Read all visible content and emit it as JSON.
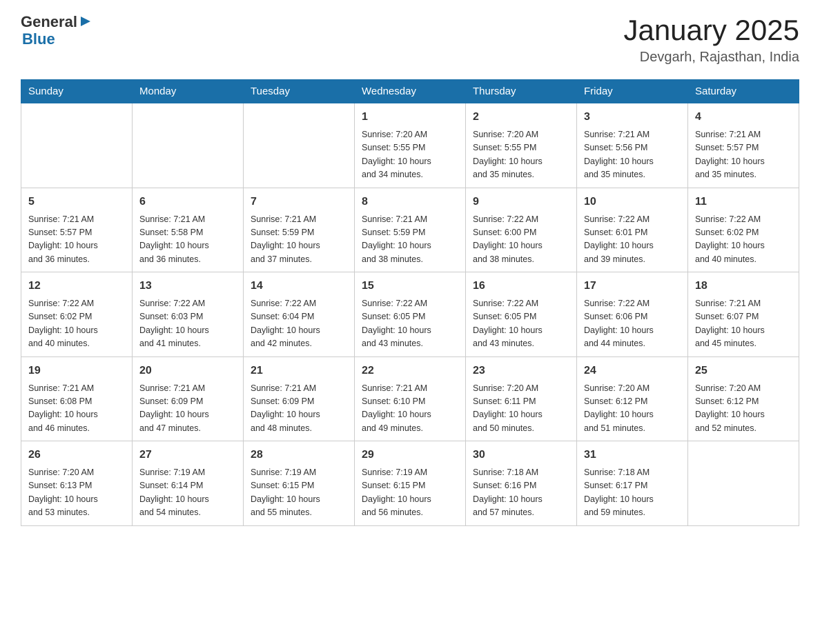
{
  "header": {
    "logo": {
      "general": "General",
      "blue": "Blue"
    },
    "title": "January 2025",
    "subtitle": "Devgarh, Rajasthan, India"
  },
  "days_of_week": [
    "Sunday",
    "Monday",
    "Tuesday",
    "Wednesday",
    "Thursday",
    "Friday",
    "Saturday"
  ],
  "weeks": [
    [
      {
        "day": "",
        "info": ""
      },
      {
        "day": "",
        "info": ""
      },
      {
        "day": "",
        "info": ""
      },
      {
        "day": "1",
        "info": "Sunrise: 7:20 AM\nSunset: 5:55 PM\nDaylight: 10 hours\nand 34 minutes."
      },
      {
        "day": "2",
        "info": "Sunrise: 7:20 AM\nSunset: 5:55 PM\nDaylight: 10 hours\nand 35 minutes."
      },
      {
        "day": "3",
        "info": "Sunrise: 7:21 AM\nSunset: 5:56 PM\nDaylight: 10 hours\nand 35 minutes."
      },
      {
        "day": "4",
        "info": "Sunrise: 7:21 AM\nSunset: 5:57 PM\nDaylight: 10 hours\nand 35 minutes."
      }
    ],
    [
      {
        "day": "5",
        "info": "Sunrise: 7:21 AM\nSunset: 5:57 PM\nDaylight: 10 hours\nand 36 minutes."
      },
      {
        "day": "6",
        "info": "Sunrise: 7:21 AM\nSunset: 5:58 PM\nDaylight: 10 hours\nand 36 minutes."
      },
      {
        "day": "7",
        "info": "Sunrise: 7:21 AM\nSunset: 5:59 PM\nDaylight: 10 hours\nand 37 minutes."
      },
      {
        "day": "8",
        "info": "Sunrise: 7:21 AM\nSunset: 5:59 PM\nDaylight: 10 hours\nand 38 minutes."
      },
      {
        "day": "9",
        "info": "Sunrise: 7:22 AM\nSunset: 6:00 PM\nDaylight: 10 hours\nand 38 minutes."
      },
      {
        "day": "10",
        "info": "Sunrise: 7:22 AM\nSunset: 6:01 PM\nDaylight: 10 hours\nand 39 minutes."
      },
      {
        "day": "11",
        "info": "Sunrise: 7:22 AM\nSunset: 6:02 PM\nDaylight: 10 hours\nand 40 minutes."
      }
    ],
    [
      {
        "day": "12",
        "info": "Sunrise: 7:22 AM\nSunset: 6:02 PM\nDaylight: 10 hours\nand 40 minutes."
      },
      {
        "day": "13",
        "info": "Sunrise: 7:22 AM\nSunset: 6:03 PM\nDaylight: 10 hours\nand 41 minutes."
      },
      {
        "day": "14",
        "info": "Sunrise: 7:22 AM\nSunset: 6:04 PM\nDaylight: 10 hours\nand 42 minutes."
      },
      {
        "day": "15",
        "info": "Sunrise: 7:22 AM\nSunset: 6:05 PM\nDaylight: 10 hours\nand 43 minutes."
      },
      {
        "day": "16",
        "info": "Sunrise: 7:22 AM\nSunset: 6:05 PM\nDaylight: 10 hours\nand 43 minutes."
      },
      {
        "day": "17",
        "info": "Sunrise: 7:22 AM\nSunset: 6:06 PM\nDaylight: 10 hours\nand 44 minutes."
      },
      {
        "day": "18",
        "info": "Sunrise: 7:21 AM\nSunset: 6:07 PM\nDaylight: 10 hours\nand 45 minutes."
      }
    ],
    [
      {
        "day": "19",
        "info": "Sunrise: 7:21 AM\nSunset: 6:08 PM\nDaylight: 10 hours\nand 46 minutes."
      },
      {
        "day": "20",
        "info": "Sunrise: 7:21 AM\nSunset: 6:09 PM\nDaylight: 10 hours\nand 47 minutes."
      },
      {
        "day": "21",
        "info": "Sunrise: 7:21 AM\nSunset: 6:09 PM\nDaylight: 10 hours\nand 48 minutes."
      },
      {
        "day": "22",
        "info": "Sunrise: 7:21 AM\nSunset: 6:10 PM\nDaylight: 10 hours\nand 49 minutes."
      },
      {
        "day": "23",
        "info": "Sunrise: 7:20 AM\nSunset: 6:11 PM\nDaylight: 10 hours\nand 50 minutes."
      },
      {
        "day": "24",
        "info": "Sunrise: 7:20 AM\nSunset: 6:12 PM\nDaylight: 10 hours\nand 51 minutes."
      },
      {
        "day": "25",
        "info": "Sunrise: 7:20 AM\nSunset: 6:12 PM\nDaylight: 10 hours\nand 52 minutes."
      }
    ],
    [
      {
        "day": "26",
        "info": "Sunrise: 7:20 AM\nSunset: 6:13 PM\nDaylight: 10 hours\nand 53 minutes."
      },
      {
        "day": "27",
        "info": "Sunrise: 7:19 AM\nSunset: 6:14 PM\nDaylight: 10 hours\nand 54 minutes."
      },
      {
        "day": "28",
        "info": "Sunrise: 7:19 AM\nSunset: 6:15 PM\nDaylight: 10 hours\nand 55 minutes."
      },
      {
        "day": "29",
        "info": "Sunrise: 7:19 AM\nSunset: 6:15 PM\nDaylight: 10 hours\nand 56 minutes."
      },
      {
        "day": "30",
        "info": "Sunrise: 7:18 AM\nSunset: 6:16 PM\nDaylight: 10 hours\nand 57 minutes."
      },
      {
        "day": "31",
        "info": "Sunrise: 7:18 AM\nSunset: 6:17 PM\nDaylight: 10 hours\nand 59 minutes."
      },
      {
        "day": "",
        "info": ""
      }
    ]
  ]
}
